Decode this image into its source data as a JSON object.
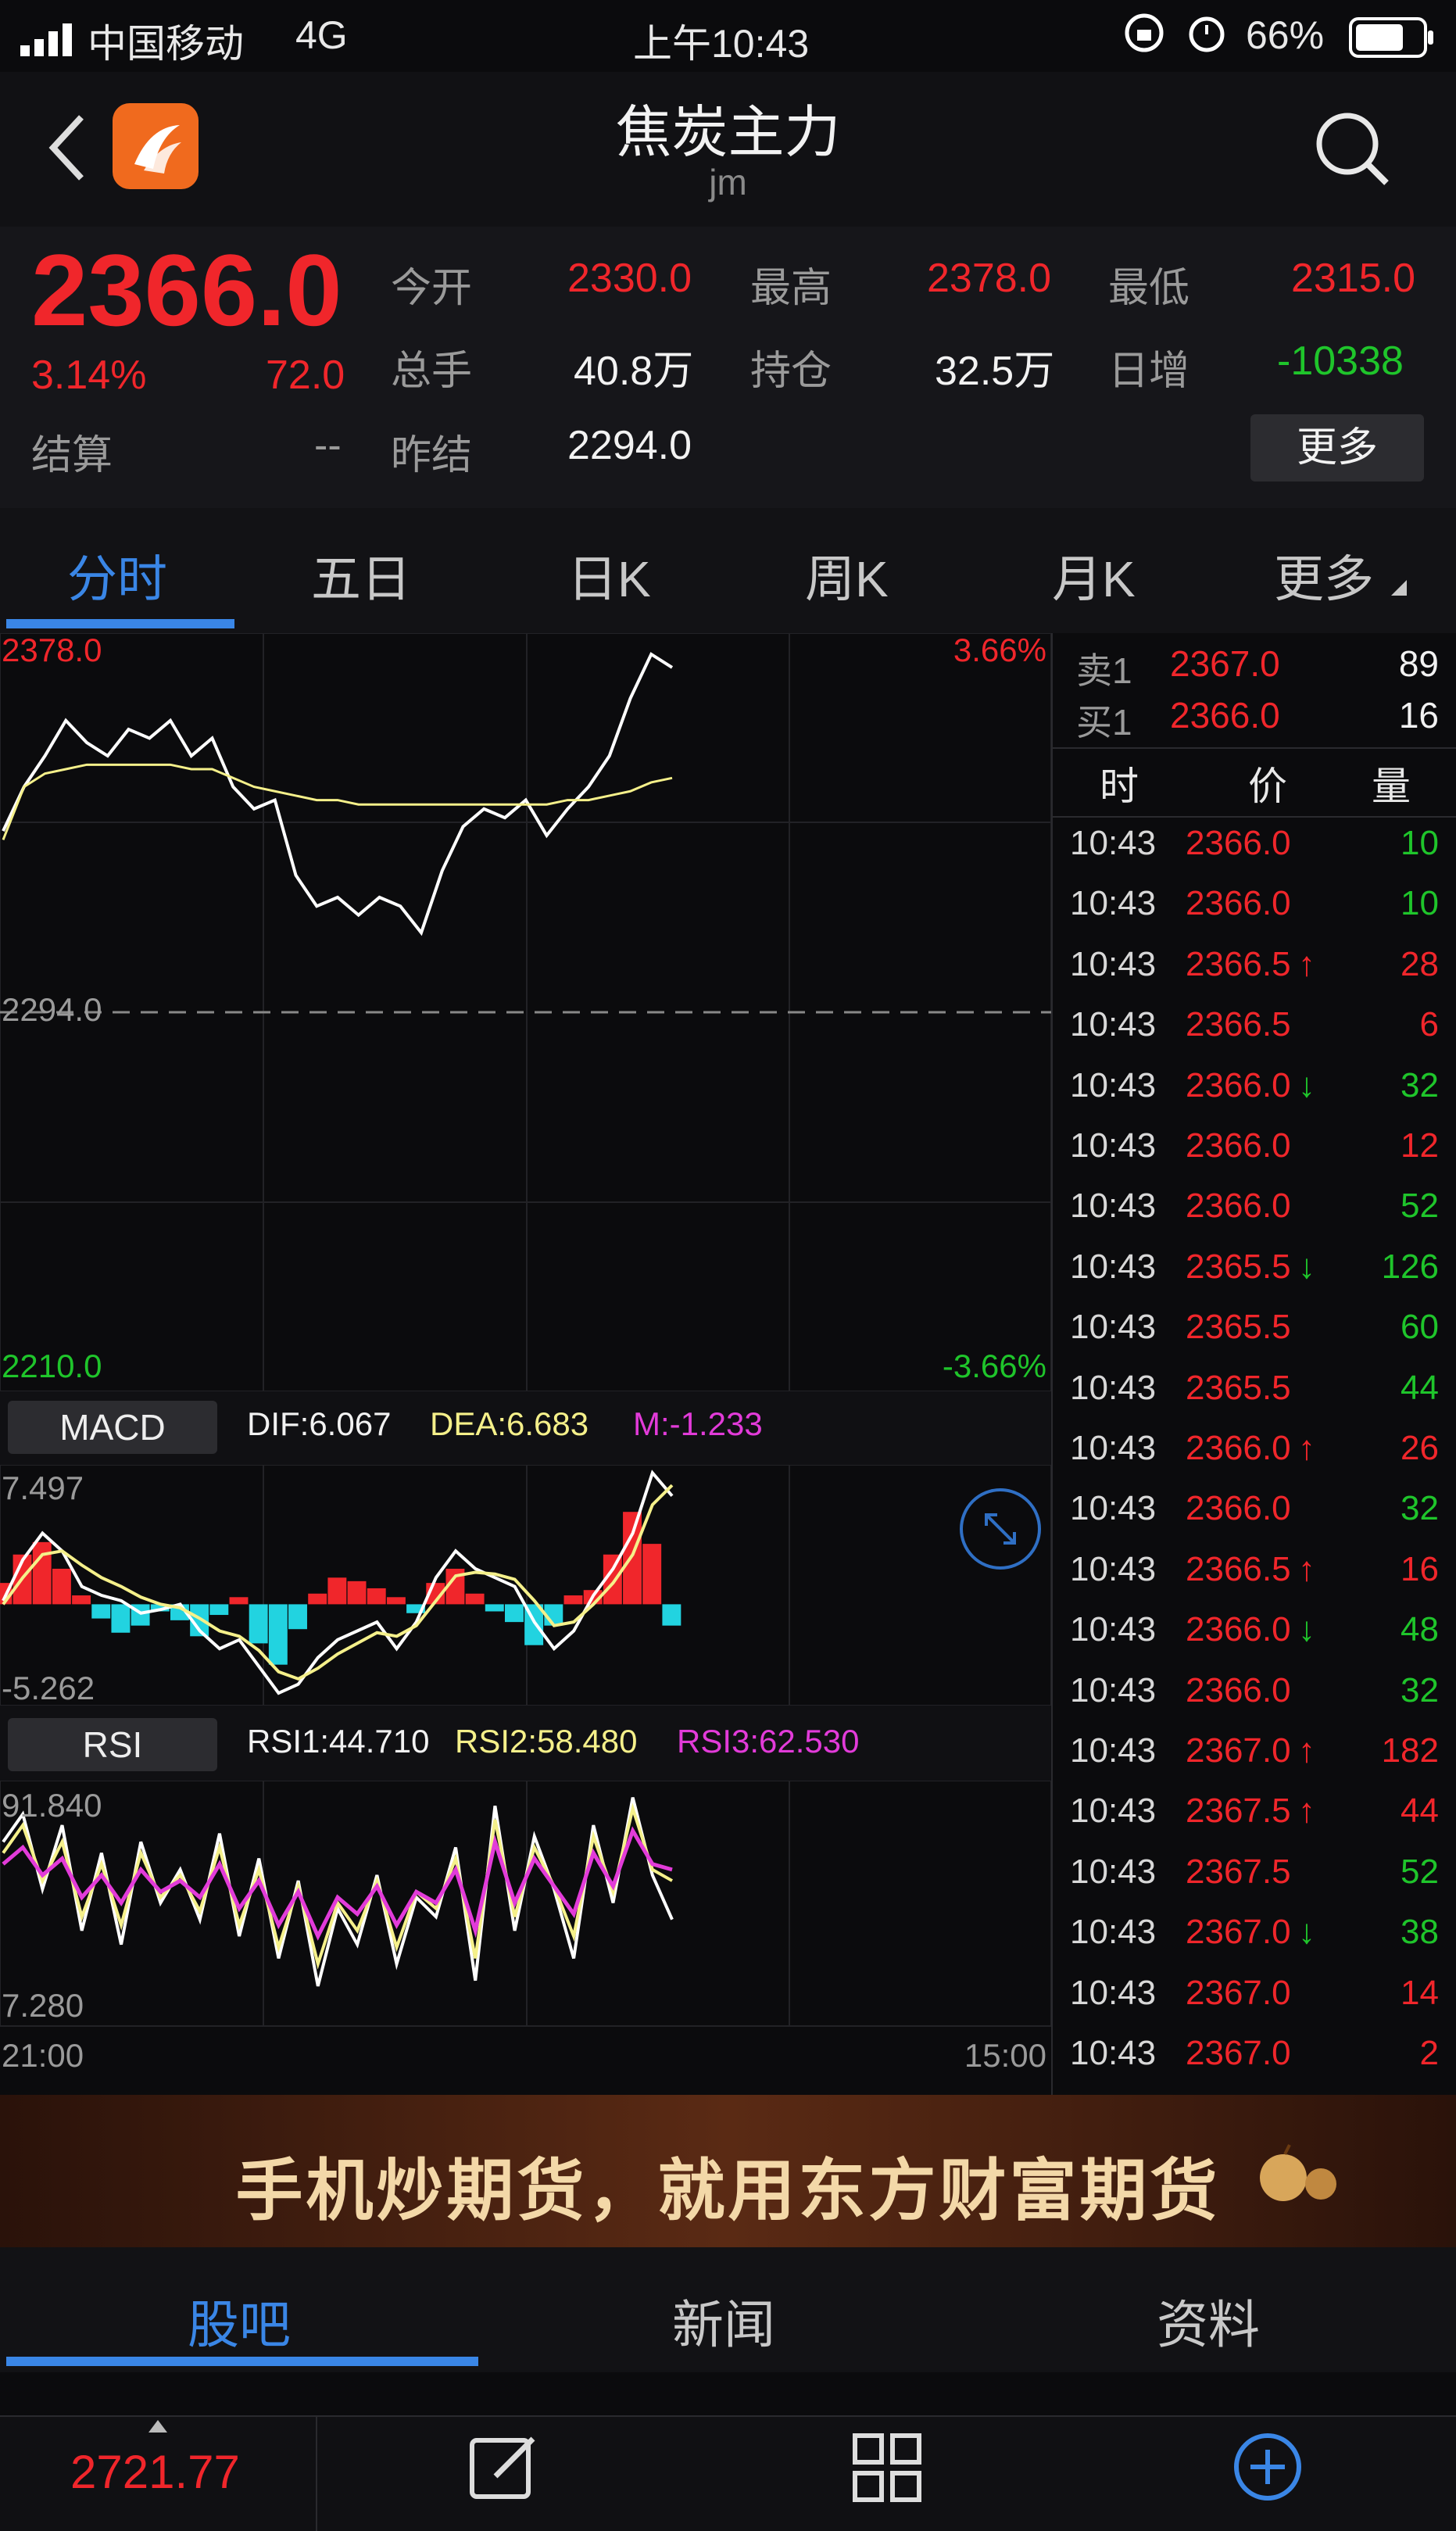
{
  "status_bar": {
    "carrier": "中国移动",
    "network": "4G",
    "time": "上午10:43",
    "battery": "66%"
  },
  "nav": {
    "title": "焦炭主力",
    "code": "jm"
  },
  "quote": {
    "price": "2366.0",
    "change_pct": "3.14%",
    "change": "72.0",
    "fields": [
      {
        "label": "今开",
        "value": "2330.0",
        "color": "red"
      },
      {
        "label": "最高",
        "value": "2378.0",
        "color": "red"
      },
      {
        "label": "最低",
        "value": "2315.0",
        "color": "red"
      },
      {
        "label": "总手",
        "value": "40.8万",
        "color": "white"
      },
      {
        "label": "持仓",
        "value": "32.5万",
        "color": "white"
      },
      {
        "label": "日增",
        "value": "-10338",
        "color": "green"
      }
    ],
    "settle_label": "结算",
    "settle_value": "--",
    "prev_settle_label": "昨结",
    "prev_settle_value": "2294.0",
    "more_button": "更多"
  },
  "tabs": [
    "分时",
    "五日",
    "日K",
    "周K",
    "月K",
    "更多"
  ],
  "chart_data": [
    {
      "type": "line",
      "x": [
        "21:00",
        "15:00"
      ],
      "ylim": [
        2210.0,
        2378.0
      ],
      "ref_line": 2294.0,
      "axis": {
        "top": "2378.0",
        "mid": "2294.0",
        "bottom": "2210.0",
        "pct_top": "3.66%",
        "pct_bottom": "-3.66%",
        "x_start": "21:00",
        "x_end": "15:00"
      },
      "series": [
        {
          "values": [
            2335,
            2345,
            2352,
            2360,
            2355,
            2352,
            2358,
            2356,
            2360,
            2352,
            2356,
            2345,
            2340,
            2342,
            2325,
            2318,
            2320,
            2316,
            2320,
            2318,
            2312,
            2326,
            2336,
            2340,
            2338,
            2342,
            2334,
            2340,
            2345,
            2352,
            2365,
            2375,
            2372
          ]
        },
        {
          "values": [
            2333,
            2345,
            2348,
            2349,
            2350,
            2350,
            2350,
            2350,
            2350,
            2349,
            2349,
            2347,
            2345,
            2344,
            2343,
            2342,
            2342,
            2341,
            2341,
            2341,
            2341,
            2341,
            2341,
            2341,
            2341,
            2341,
            2341,
            2342,
            2342,
            2343,
            2344,
            2346,
            2347
          ]
        }
      ]
    },
    {
      "type": "bar",
      "name": "MACD",
      "ylim": [
        -5.262,
        7.497
      ],
      "axis": {
        "top": "7.497",
        "bottom": "-5.262"
      },
      "legend": {
        "dif": "DIF:6.067",
        "dea": "DEA:6.683",
        "m": "M:-1.233"
      },
      "values": [
        1.2,
        2.8,
        3.5,
        2.0,
        0.5,
        -0.8,
        -1.6,
        -1.2,
        -0.4,
        -0.9,
        -1.8,
        -0.6,
        0.4,
        -2.2,
        -3.4,
        -1.4,
        0.6,
        1.5,
        1.3,
        0.9,
        0.4,
        -0.5,
        1.2,
        2.0,
        0.6,
        -0.4,
        -1.0,
        -2.3,
        -1.2,
        0.5,
        0.8,
        2.8,
        5.2,
        3.4,
        -1.2
      ],
      "series": [
        {
          "values": [
            0.2,
            2.5,
            4.0,
            3.0,
            1.0,
            0.5,
            0.2,
            -0.5,
            -0.3,
            0.0,
            -1.5,
            -2.5,
            -2.0,
            -3.5,
            -5.0,
            -4.5,
            -3.0,
            -2.0,
            -1.5,
            -1.0,
            -2.5,
            -1.0,
            1.5,
            3.0,
            2.0,
            1.5,
            1.0,
            -1.0,
            -2.5,
            -1.5,
            0.5,
            2.0,
            4.0,
            7.4,
            6.1
          ]
        },
        {
          "values": [
            0.0,
            1.5,
            2.8,
            3.0,
            2.2,
            1.5,
            1.0,
            0.4,
            0.0,
            -0.2,
            -0.8,
            -1.5,
            -1.8,
            -2.6,
            -3.8,
            -4.2,
            -3.6,
            -2.8,
            -2.2,
            -1.6,
            -1.8,
            -1.2,
            0.2,
            1.6,
            1.8,
            1.7,
            1.4,
            0.2,
            -1.2,
            -1.0,
            0.0,
            1.2,
            2.8,
            5.6,
            6.7
          ]
        }
      ]
    },
    {
      "type": "line",
      "name": "RSI",
      "ylim": [
        7.28,
        91.84
      ],
      "axis": {
        "top": "91.840",
        "bottom": "7.280"
      },
      "legend": {
        "rsi1": "RSI1:44.710",
        "rsi2": "RSI2:58.480",
        "rsi3": "RSI3:62.530"
      },
      "series": [
        {
          "values": [
            72,
            82,
            55,
            78,
            40,
            68,
            35,
            72,
            50,
            62,
            44,
            75,
            38,
            66,
            30,
            58,
            20,
            48,
            35,
            60,
            28,
            52,
            45,
            70,
            22,
            85,
            40,
            74,
            55,
            30,
            78,
            50,
            88,
            60,
            44
          ]
        },
        {
          "values": [
            68,
            78,
            58,
            72,
            45,
            64,
            42,
            68,
            52,
            60,
            47,
            70,
            42,
            62,
            34,
            56,
            28,
            50,
            40,
            58,
            34,
            54,
            48,
            66,
            30,
            80,
            45,
            70,
            56,
            38,
            74,
            54,
            84,
            62,
            58
          ]
        },
        {
          "values": [
            64,
            70,
            60,
            66,
            52,
            60,
            50,
            62,
            54,
            58,
            52,
            64,
            48,
            58,
            42,
            54,
            38,
            52,
            46,
            56,
            42,
            54,
            50,
            62,
            40,
            72,
            50,
            66,
            56,
            46,
            68,
            56,
            76,
            64,
            62
          ]
        }
      ]
    }
  ],
  "trades": {
    "ask": {
      "label": "卖1",
      "price": "2367.0",
      "vol": "89"
    },
    "bid": {
      "label": "买1",
      "price": "2366.0",
      "vol": "16"
    },
    "headers": [
      "时",
      "价",
      "量"
    ],
    "rows": [
      {
        "t": "10:43",
        "p": "2366.0",
        "d": "",
        "v": "10",
        "vc": "green"
      },
      {
        "t": "10:43",
        "p": "2366.0",
        "d": "",
        "v": "10",
        "vc": "green"
      },
      {
        "t": "10:43",
        "p": "2366.5",
        "d": "↑",
        "v": "28",
        "vc": "red"
      },
      {
        "t": "10:43",
        "p": "2366.5",
        "d": "",
        "v": "6",
        "vc": "red"
      },
      {
        "t": "10:43",
        "p": "2366.0",
        "d": "↓",
        "v": "32",
        "vc": "green"
      },
      {
        "t": "10:43",
        "p": "2366.0",
        "d": "",
        "v": "12",
        "vc": "red"
      },
      {
        "t": "10:43",
        "p": "2366.0",
        "d": "",
        "v": "52",
        "vc": "green"
      },
      {
        "t": "10:43",
        "p": "2365.5",
        "d": "↓",
        "v": "126",
        "vc": "green"
      },
      {
        "t": "10:43",
        "p": "2365.5",
        "d": "",
        "v": "60",
        "vc": "green"
      },
      {
        "t": "10:43",
        "p": "2365.5",
        "d": "",
        "v": "44",
        "vc": "green"
      },
      {
        "t": "10:43",
        "p": "2366.0",
        "d": "↑",
        "v": "26",
        "vc": "red"
      },
      {
        "t": "10:43",
        "p": "2366.0",
        "d": "",
        "v": "32",
        "vc": "green"
      },
      {
        "t": "10:43",
        "p": "2366.5",
        "d": "↑",
        "v": "16",
        "vc": "red"
      },
      {
        "t": "10:43",
        "p": "2366.0",
        "d": "↓",
        "v": "48",
        "vc": "green"
      },
      {
        "t": "10:43",
        "p": "2366.0",
        "d": "",
        "v": "32",
        "vc": "green"
      },
      {
        "t": "10:43",
        "p": "2367.0",
        "d": "↑",
        "v": "182",
        "vc": "red"
      },
      {
        "t": "10:43",
        "p": "2367.5",
        "d": "↑",
        "v": "44",
        "vc": "red"
      },
      {
        "t": "10:43",
        "p": "2367.5",
        "d": "",
        "v": "52",
        "vc": "green"
      },
      {
        "t": "10:43",
        "p": "2367.0",
        "d": "↓",
        "v": "38",
        "vc": "green"
      },
      {
        "t": "10:43",
        "p": "2367.0",
        "d": "",
        "v": "14",
        "vc": "red"
      },
      {
        "t": "10:43",
        "p": "2367.0",
        "d": "",
        "v": "2",
        "vc": "red"
      }
    ]
  },
  "banner": {
    "text": "手机炒期货，就用东方财富期货"
  },
  "bottom_tabs": [
    "股吧",
    "新闻",
    "资料"
  ],
  "bottom_bar": {
    "index_value": "2721.77"
  },
  "colors": {
    "up": "#f0262b",
    "down": "#1fc52b",
    "accent": "#3a86e6",
    "avg": "#f5f08a",
    "macd_neg": "#22d3e0"
  }
}
